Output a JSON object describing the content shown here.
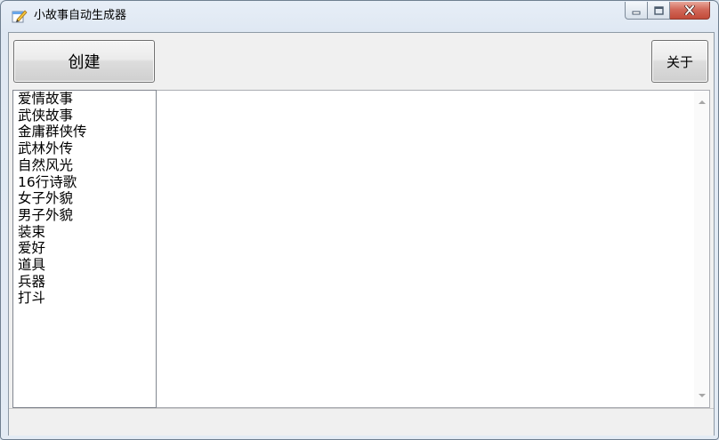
{
  "window": {
    "title": "小故事自动生成器"
  },
  "toolbar": {
    "create_label": "创建",
    "about_label": "关于"
  },
  "categories": [
    "爱情故事",
    "武侠故事",
    "金庸群侠传",
    "武林外传",
    "自然风光",
    "16行诗歌",
    "女子外貌",
    "男子外貌",
    "装束",
    "爱好",
    "道具",
    "兵器",
    "打斗"
  ],
  "output": {
    "text": ""
  },
  "colors": {
    "close_button": "#c94a3a",
    "client_bg": "#f0f0f0"
  }
}
